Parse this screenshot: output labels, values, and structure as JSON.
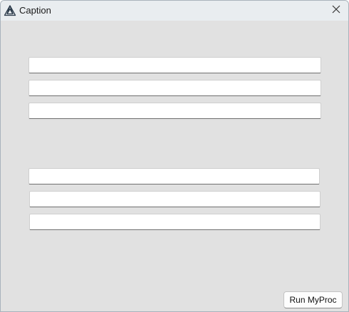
{
  "window": {
    "title": "Caption",
    "app_icon": "triangle-logo-icon",
    "close_icon": "close-icon"
  },
  "form": {
    "fields_group_1": [
      {
        "value": ""
      },
      {
        "value": ""
      },
      {
        "value": ""
      }
    ],
    "fields_group_2": [
      {
        "value": ""
      },
      {
        "value": ""
      },
      {
        "value": ""
      }
    ],
    "run_button_label": "Run MyProc"
  },
  "colors": {
    "background": "#e1e1e1",
    "titlebar": "#e9edf0",
    "field_background": "#ffffff"
  }
}
